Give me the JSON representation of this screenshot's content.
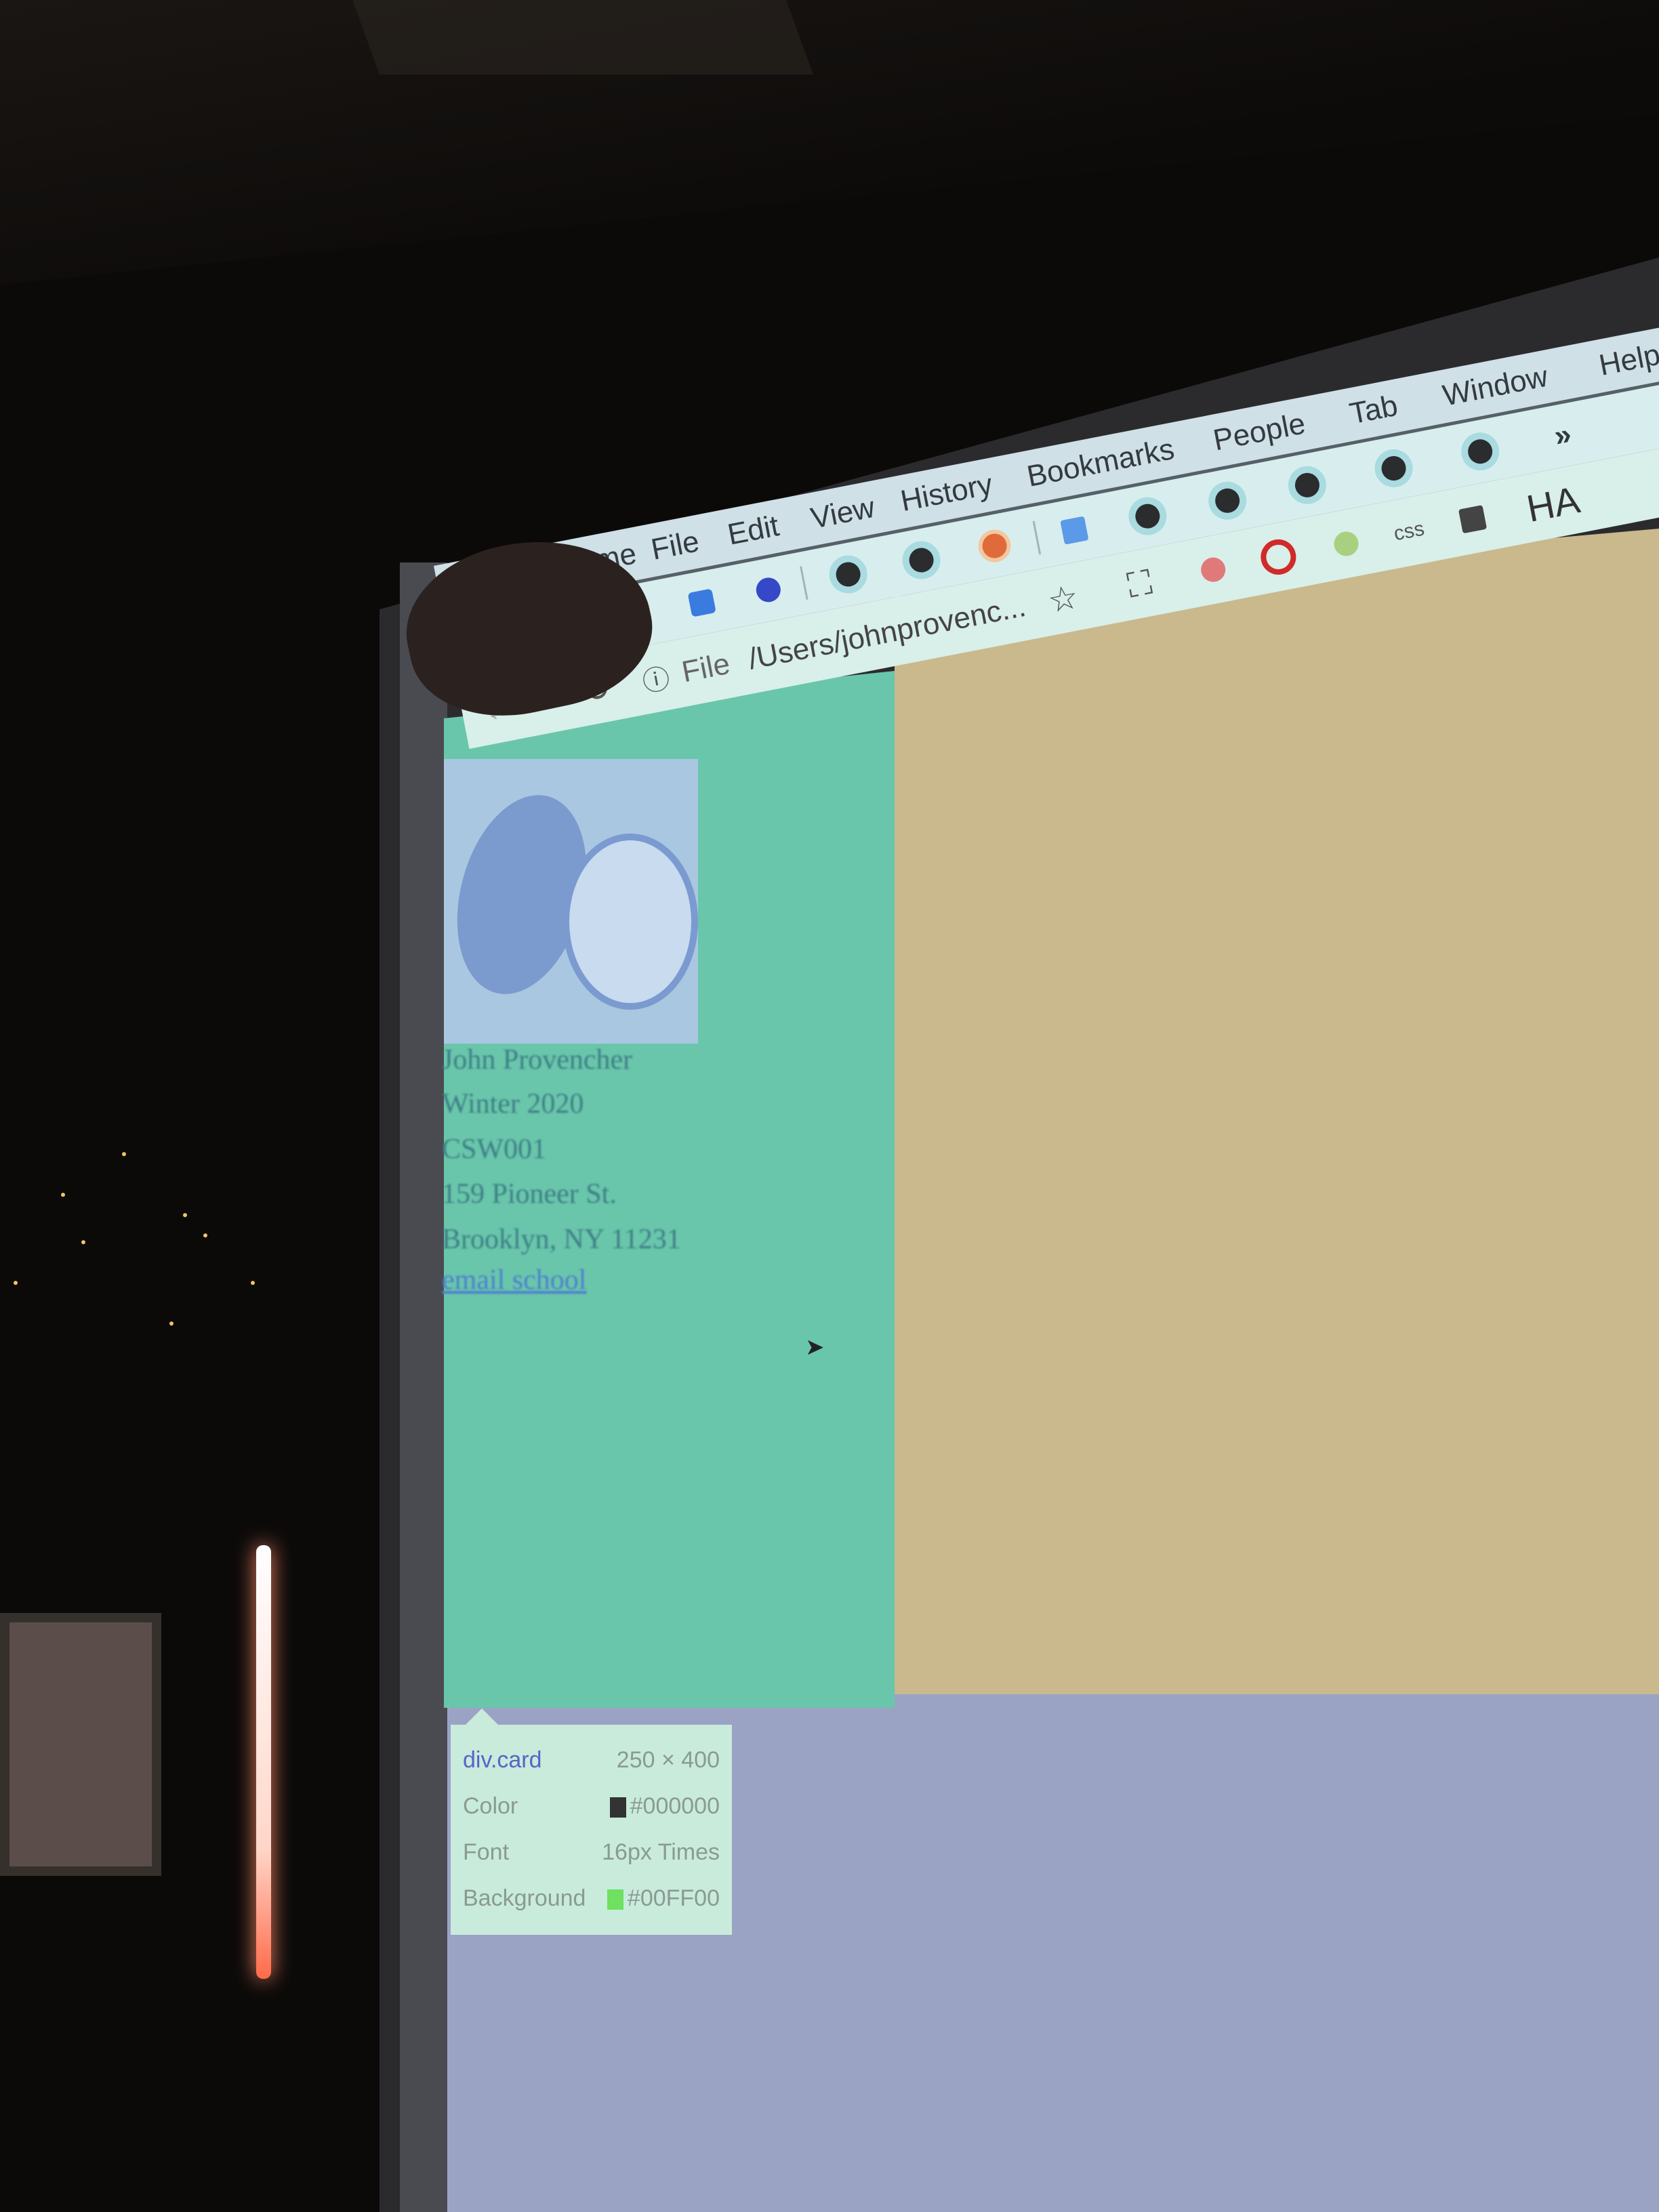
{
  "menubar": {
    "items": [
      "Chrome",
      "File",
      "Edit",
      "View",
      "History",
      "Bookmarks",
      "People",
      "Tab",
      "Window",
      "Help"
    ]
  },
  "bookmarks_bar": {
    "overflow_label": "»",
    "icons": [
      "app-icon",
      "blue-circle-icon",
      "favicon",
      "favicon",
      "star-badge-icon",
      "p-icon",
      "favicon",
      "favicon",
      "favicon",
      "favicon",
      "favicon"
    ]
  },
  "address_bar": {
    "scheme_label": "File",
    "url": "/Users/johnprovenc...",
    "extension_labels": {
      "css": "css",
      "ha": "HA"
    }
  },
  "card": {
    "lines": [
      "John Provencher",
      "Winter 2020",
      "CSW001",
      "159 Pioneer St.",
      "Brooklyn, NY 11231"
    ],
    "link": "email school"
  },
  "inspector_tooltip": {
    "selector": "div.card",
    "dimensions": "250 × 400",
    "rows": [
      {
        "label": "Color",
        "value": "#000000",
        "swatch": "#000000"
      },
      {
        "label": "Font",
        "value": "16px Times"
      },
      {
        "label": "Background",
        "value": "#00FF00",
        "swatch": "#00FF00"
      }
    ]
  },
  "colors": {
    "teal_panel": "#69c6ab",
    "tan_panel": "#c9b98c",
    "lavender_panel": "#9ba3c5"
  }
}
